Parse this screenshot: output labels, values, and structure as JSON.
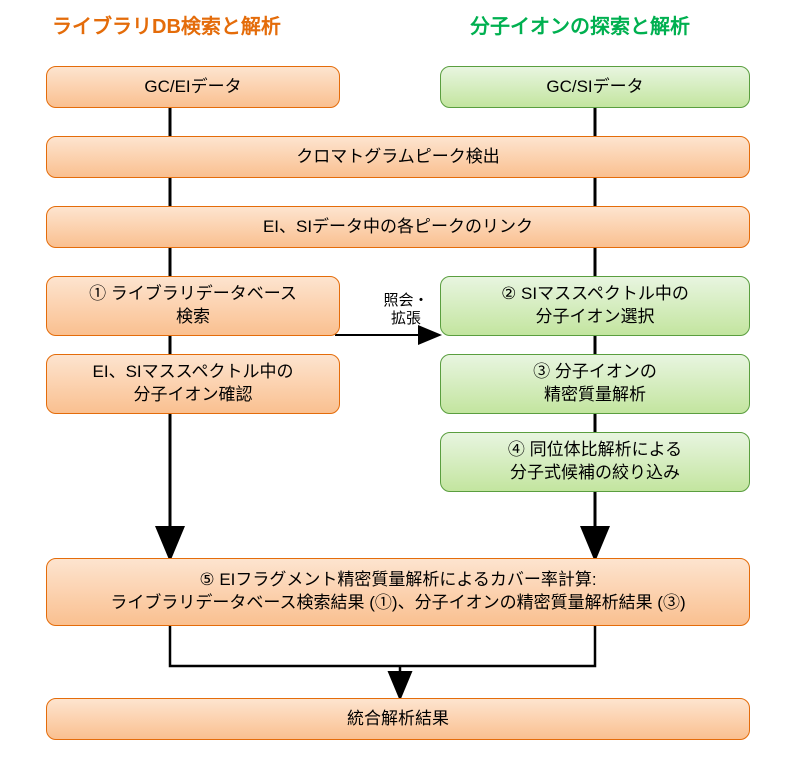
{
  "headers": {
    "left": "ライブラリDB検索と解析",
    "right": "分子イオンの探索と解析"
  },
  "boxes": {
    "gc_ei": "GC/EIデータ",
    "gc_si": "GC/SIデータ",
    "chromato": "クロマトグラムピーク検出",
    "link": "EI、SIデータ中の各ピークのリンク",
    "lib_search_line1": "① ライブラリデータベース",
    "lib_search_line2": "検索",
    "ion_confirm_line1": "EI、SIマススペクトル中の",
    "ion_confirm_line2": "分子イオン確認",
    "si_select_line1": "② SIマススペクトル中の",
    "si_select_line2": "分子イオン選択",
    "precise_line1": "③ 分子イオンの",
    "precise_line2": "精密質量解析",
    "isotope_line1": "④ 同位体比解析による",
    "isotope_line2": "分子式候補の絞り込み",
    "fragment_line1": "⑤ EIフラグメント精密質量解析によるカバー率計算:",
    "fragment_line2": "ライブラリデータベース検索結果 (①)、分子イオンの精密質量解析結果 (③)",
    "result": "統合解析結果"
  },
  "annotation": {
    "line1": "照会・",
    "line2": "拡張"
  },
  "colors": {
    "orange_border": "#e46c0a",
    "green_border": "#5a9e3f",
    "arrow": "#000000"
  }
}
